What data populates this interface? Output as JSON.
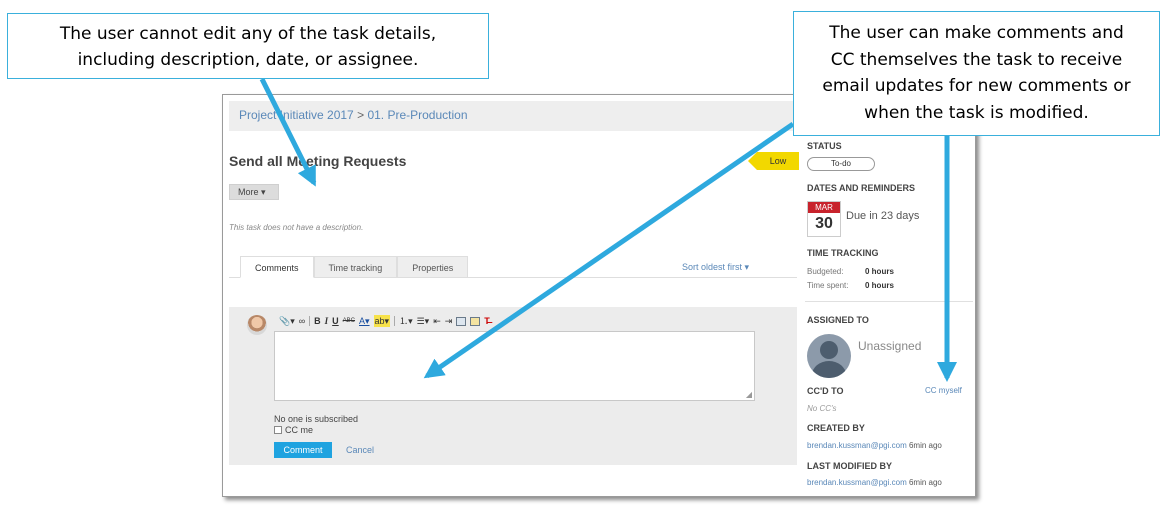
{
  "callouts": {
    "left": [
      "The user cannot edit any of the task details,",
      "including description, date, or assignee."
    ],
    "right": [
      "The user can make comments and",
      "CC themselves the task to receive",
      "email updates for new comments or",
      "when the task is modified."
    ]
  },
  "breadcrumb": {
    "project": "Project Initiative 2017",
    "separator": ">",
    "phase": "01. Pre-Production"
  },
  "task": {
    "title": "Send all Meeting Requests",
    "priority": "Low",
    "more_label": "More ▾",
    "description_placeholder": "This task does not have a description."
  },
  "tabs": [
    {
      "label": "Comments",
      "active": true
    },
    {
      "label": "Time tracking",
      "active": false
    },
    {
      "label": "Properties",
      "active": false
    }
  ],
  "sort_label": "Sort oldest first ▾",
  "comment_form": {
    "subscribers_text": "No one is subscribed",
    "cc_me_label": "CC me",
    "comment_button": "Comment",
    "cancel_link": "Cancel"
  },
  "sidebar": {
    "status_heading": "STATUS",
    "status_value": "To-do",
    "dates_heading": "DATES AND REMINDERS",
    "due_month": "MAR",
    "due_day": "30",
    "due_text": "Due in 23 days",
    "time_heading": "TIME TRACKING",
    "budgeted_label": "Budgeted:",
    "budgeted_value": "0 hours",
    "spent_label": "Time spent:",
    "spent_value": "0 hours",
    "assigned_heading": "ASSIGNED TO",
    "assignee": "Unassigned",
    "cc_heading": "CC'D TO",
    "cc_myself_link": "CC myself",
    "cc_empty": "No CC's",
    "created_heading": "CREATED BY",
    "created_by": "brendan.kussman@pgi.com",
    "created_ago": "6min ago",
    "modified_heading": "LAST MODIFIED BY",
    "modified_by": "brendan.kussman@pgi.com",
    "modified_ago": "6min ago"
  },
  "colors": {
    "callout_border": "#3ab0dc",
    "arrow": "#2ea9de",
    "comment_button": "#1fa3e0",
    "priority": "#f2d800",
    "calendar": "#c8232c"
  }
}
